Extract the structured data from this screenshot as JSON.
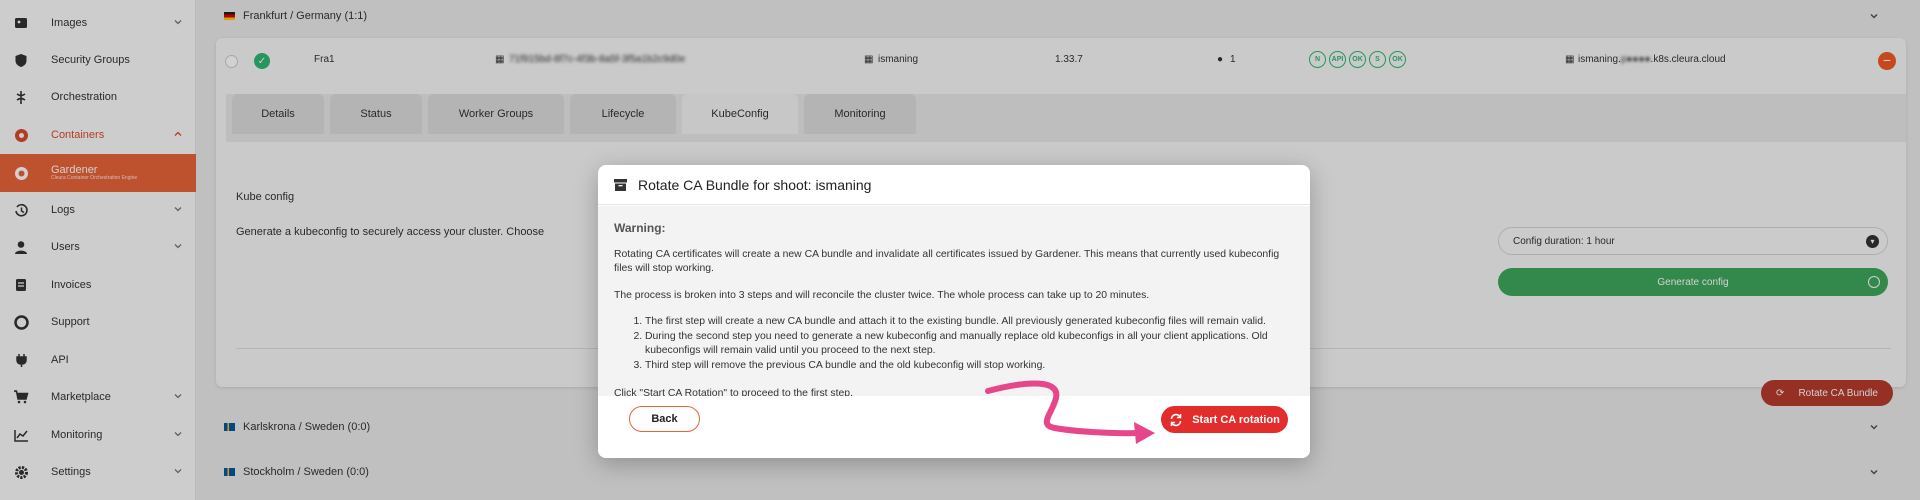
{
  "sidebar": {
    "items": [
      {
        "label": "Images",
        "icon": "image-icon",
        "chevron": "down"
      },
      {
        "label": "Security Groups",
        "icon": "shield-icon",
        "chevron": ""
      },
      {
        "label": "Orchestration",
        "icon": "orchestration-icon",
        "chevron": ""
      },
      {
        "label": "Containers",
        "icon": "containers-icon",
        "chevron": "up"
      },
      {
        "label": "Gardener",
        "sublabel": "Cleura Container Orchestration Engine",
        "icon": "gardener-icon",
        "chevron": ""
      },
      {
        "label": "Logs",
        "icon": "history-icon",
        "chevron": "down"
      },
      {
        "label": "Users",
        "icon": "user-icon",
        "chevron": "down"
      },
      {
        "label": "Invoices",
        "icon": "invoice-icon",
        "chevron": ""
      },
      {
        "label": "Support",
        "icon": "support-icon",
        "chevron": ""
      },
      {
        "label": "API",
        "icon": "plug-icon",
        "chevron": ""
      },
      {
        "label": "Marketplace",
        "icon": "cart-icon",
        "chevron": "down"
      },
      {
        "label": "Monitoring",
        "icon": "chart-icon",
        "chevron": "down"
      },
      {
        "label": "Settings",
        "icon": "gear-icon",
        "chevron": "down"
      }
    ]
  },
  "regions": {
    "frankfurt": "Frankfurt / Germany (1:1)",
    "karlskrona": "Karlskrona / Sweden (0:0)",
    "stockholm": "Stockholm / Sweden (0:0)"
  },
  "shoot": {
    "name": "Fra1",
    "id": "71f915bd-8f7c-4f3b-8a5f-3f5a1b2c9d0e",
    "project": "ismaning",
    "version": "1.33.7",
    "workers": "1",
    "status_icons": [
      "N",
      "API",
      "OK",
      "S",
      "OK"
    ],
    "endpoint_prefix": "ismaning.",
    "endpoint_suffix": ".k8s.cleura.cloud"
  },
  "tabs": [
    "Details",
    "Status",
    "Worker Groups",
    "Lifecycle",
    "KubeConfig",
    "Monitoring"
  ],
  "active_tab": "KubeConfig",
  "kubeconfig": {
    "title": "Kube config",
    "description": "Generate a kubeconfig to securely access your cluster. Choose the desired d",
    "duration_value": "Config duration: 1 hour",
    "generate_label": "Generate config",
    "rotate_label": "Rotate CA Bundle"
  },
  "modal": {
    "title": "Rotate CA Bundle for shoot: ismaning",
    "warning_label": "Warning:",
    "para1": "Rotating CA certificates will create a new CA bundle and invalidate all certificates issued by Gardener. This means that currently used kubeconfig files will stop working.",
    "para2": "The process is broken into 3 steps and will reconcile the cluster twice. The whole process can take up to 20 minutes.",
    "steps": [
      "The first step will create a new CA bundle and attach it to the existing bundle. All previously generated kubeconfig files will remain valid.",
      "During the second step you need to generate a new kubeconfig and manually replace old kubeconfigs in all your client applications. Old kubeconfigs will remain valid until you proceed to the next step.",
      "Third step will remove the previous CA bundle and the old kubeconfig will stop working."
    ],
    "instruction": "Click \"Start CA Rotation\" to proceed to the first step.",
    "back_label": "Back",
    "start_label": "Start CA rotation"
  },
  "colors": {
    "accent": "#e8643a",
    "danger": "#e32c2c",
    "success": "#2eb872",
    "annotation_arrow": "#e6478a"
  }
}
